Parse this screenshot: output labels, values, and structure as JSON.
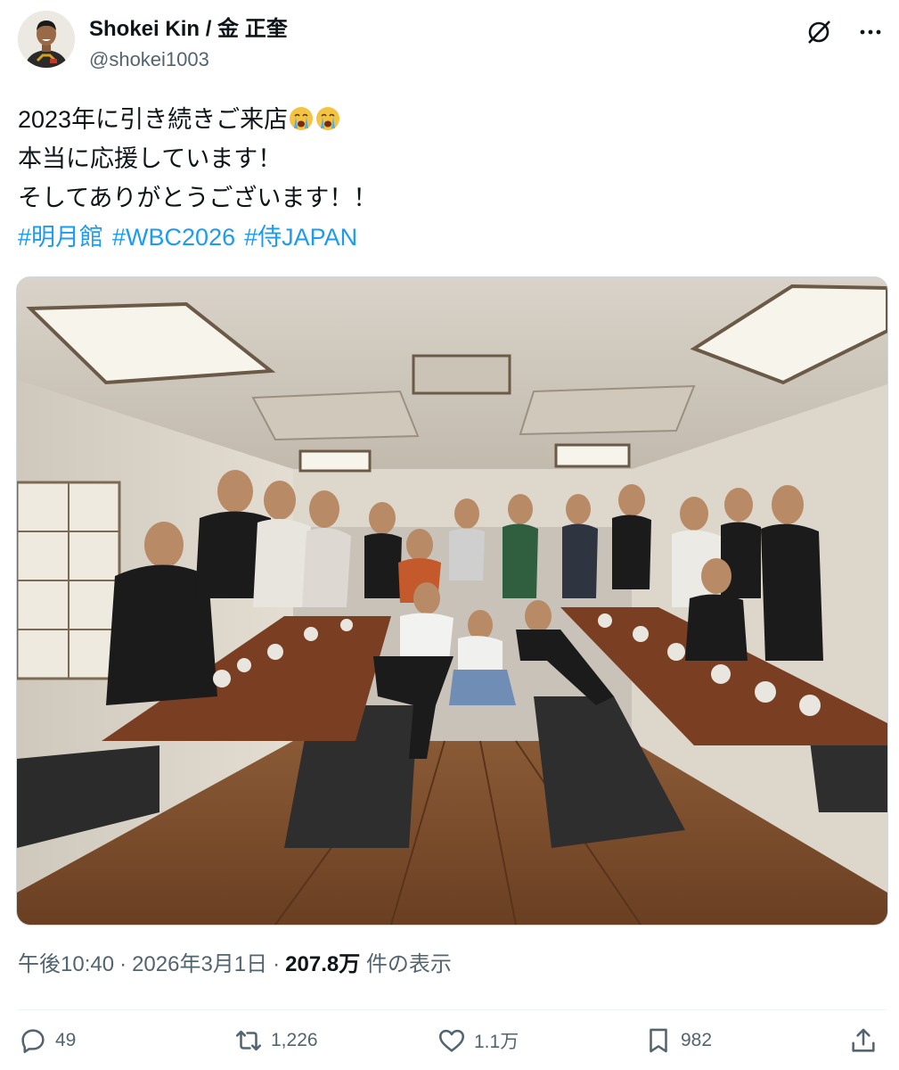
{
  "author": {
    "display_name": "Shokei Kin / 金 正奎",
    "handle": "@shokei1003"
  },
  "tweet": {
    "lines": [
      "2023年に引き続きご来店",
      "本当に応援しています！",
      "そしてありがとうございます！！"
    ],
    "emoji": [
      "loudly-crying-face",
      "loudly-crying-face"
    ],
    "hashtags": [
      "#明月館",
      "#WBC2026",
      "#侍JAPAN"
    ]
  },
  "meta": {
    "time": "午後10:40",
    "date": "2026年3月1日",
    "separator": "·",
    "views_count": "207.8万",
    "views_label": "件の表示"
  },
  "actions": {
    "reply_count": "49",
    "retweet_count": "1,226",
    "like_count": "1.1万",
    "bookmark_count": "982"
  },
  "colors": {
    "text": "#0f1419",
    "secondary": "#536471",
    "link": "#1d9bf0"
  }
}
